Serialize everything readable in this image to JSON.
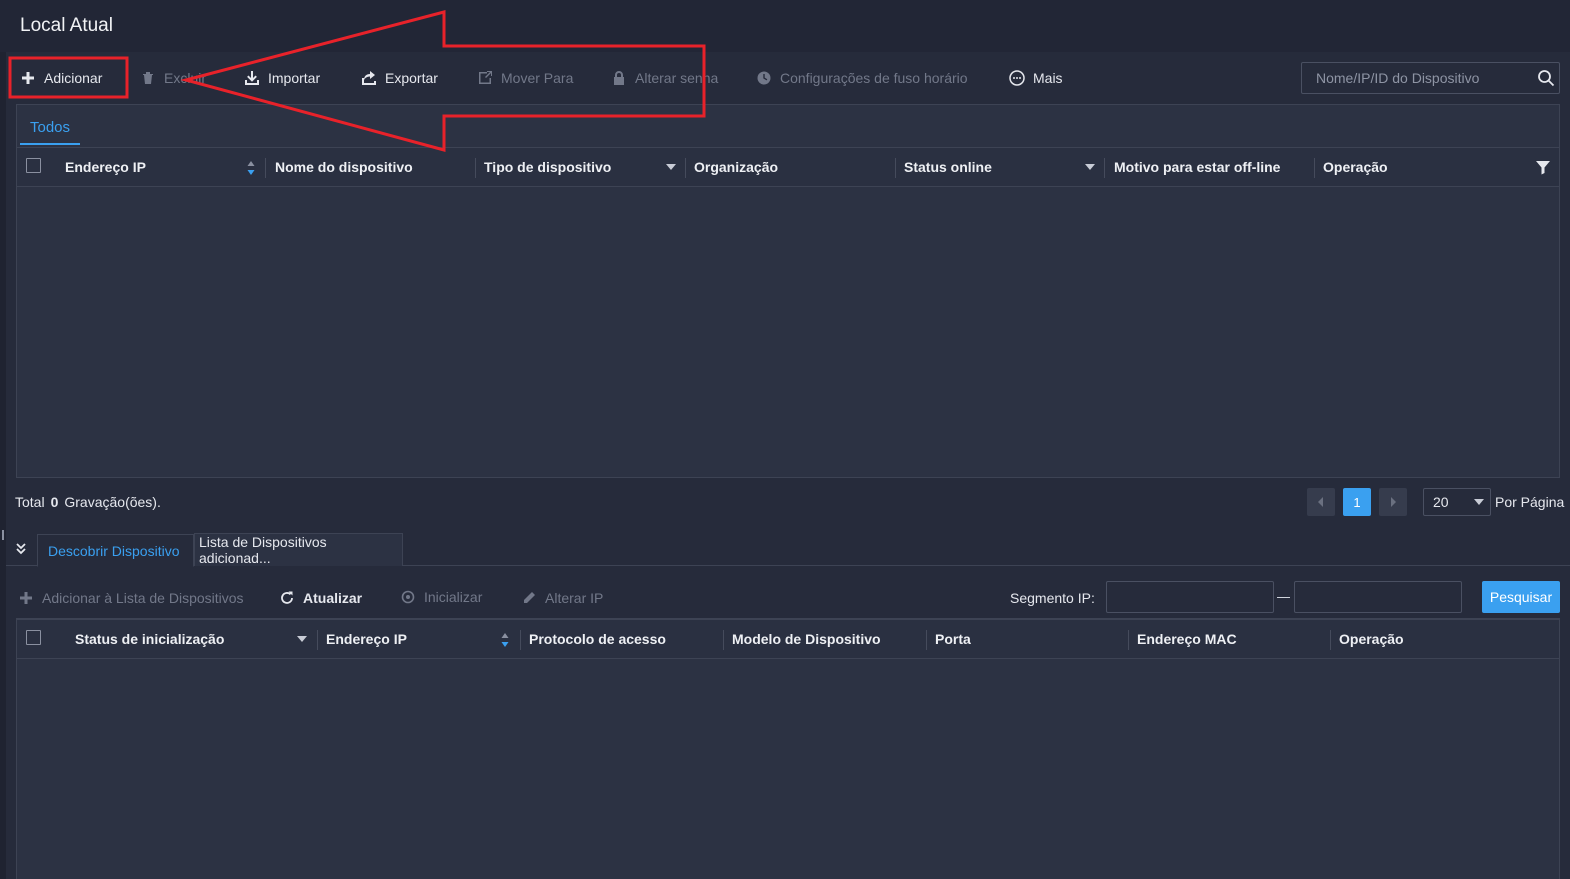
{
  "header": {
    "title": "Local Atual"
  },
  "toolbar": {
    "add": "Adicionar",
    "delete": "Excluir",
    "import": "Importar",
    "export": "Exportar",
    "move_to": "Mover Para",
    "change_password": "Alterar senha",
    "timezone": "Configurações de fuso horário",
    "more": "Mais"
  },
  "search": {
    "placeholder": "Nome/IP/ID do Dispositivo"
  },
  "device_list": {
    "tab": "Todos",
    "columns": [
      "Endereço IP",
      "Nome do dispositivo",
      "Tipo de dispositivo",
      "Organização",
      "Status online",
      "Motivo para estar off-line",
      "Operação"
    ]
  },
  "footer": {
    "total_label": "Total",
    "total_count": "0",
    "records_label": "Gravação(ões).",
    "current_page": "1",
    "per_page_value": "20",
    "per_page_label": "Por Página"
  },
  "discover": {
    "tabs": [
      "Descobrir Dispositivo",
      "Lista de Dispositivos adicionad..."
    ],
    "toolbar": {
      "add_to_list": "Adicionar à Lista de Dispositivos",
      "refresh": "Atualizar",
      "initialize": "Inicializar",
      "change_ip": "Alterar IP"
    },
    "segment_label": "Segmento IP:",
    "search_button": "Pesquisar",
    "columns": [
      "Status de inicialização",
      "Endereço IP",
      "Protocolo de acesso",
      "Modelo de Dispositivo",
      "Porta",
      "Endereço MAC",
      "Operação"
    ]
  },
  "colors": {
    "accent": "#3aa0f0",
    "background": "#262b3b",
    "annotation": "#e8222a"
  }
}
